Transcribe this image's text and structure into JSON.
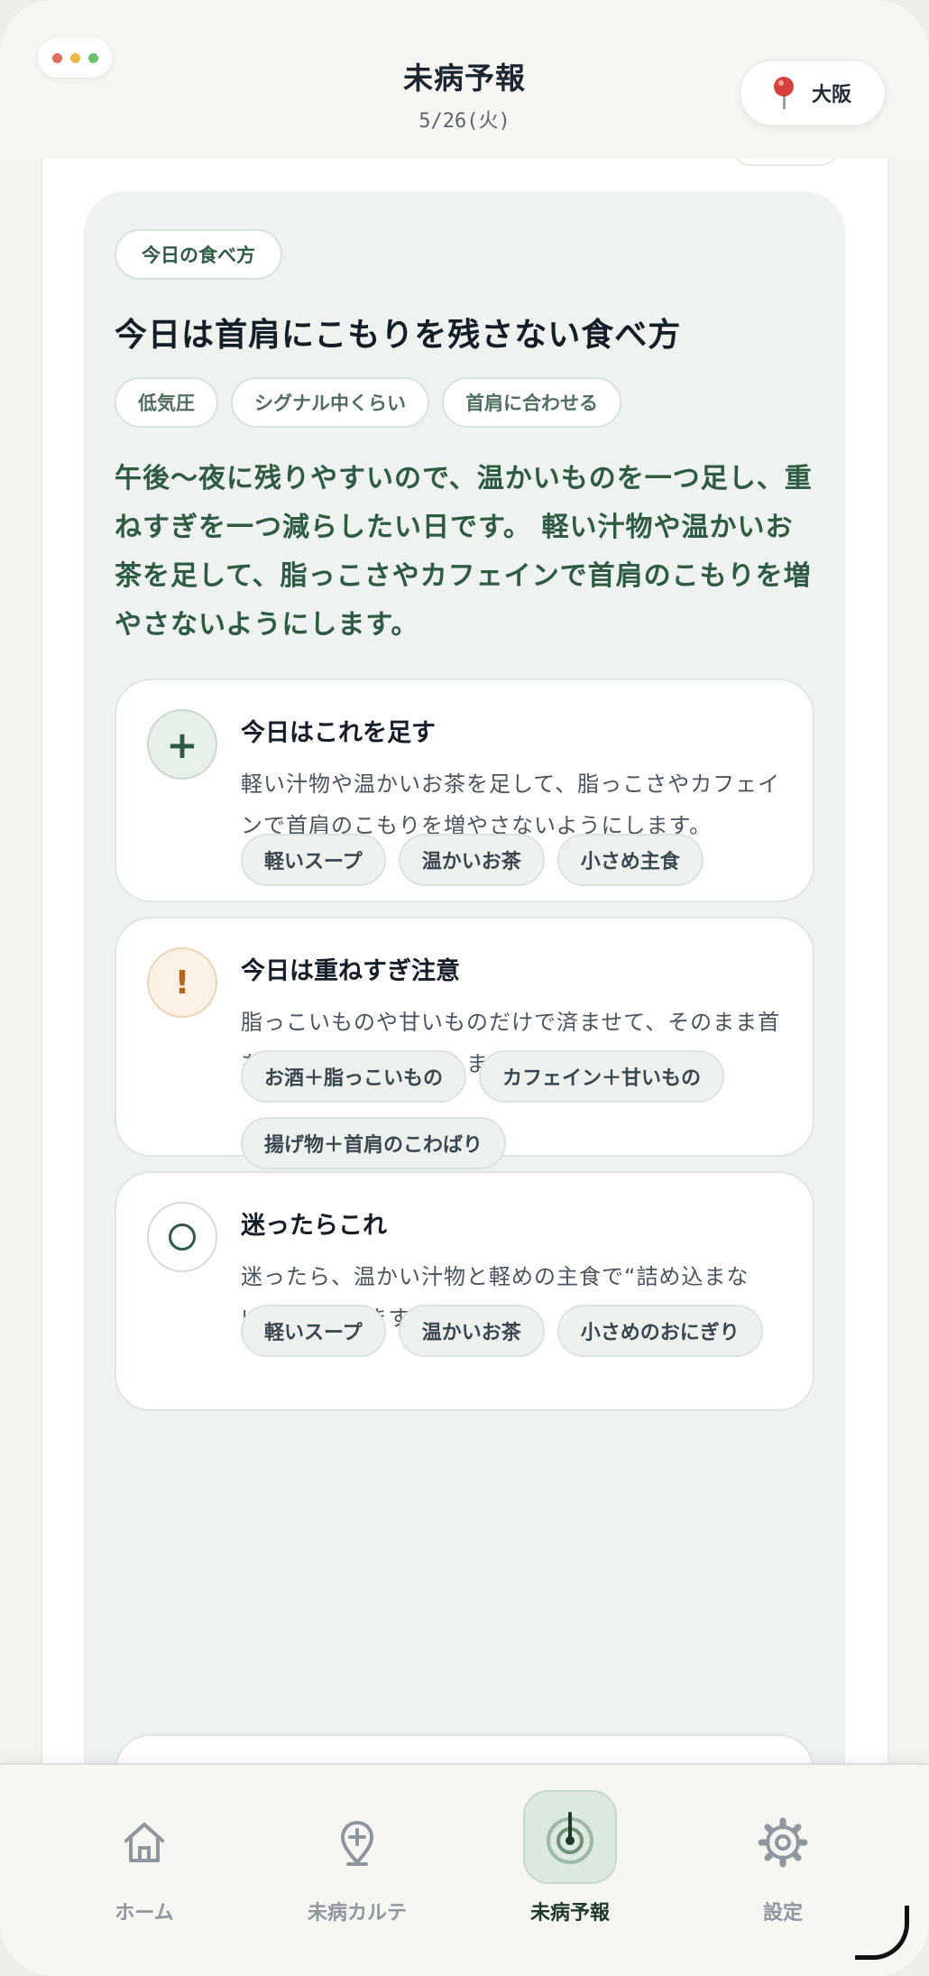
{
  "header": {
    "title": "未病予報",
    "date": "5/26(火)",
    "location": "大阪"
  },
  "card": {
    "badge": "今日の食べ方",
    "headline": "今日は首肩にこもりを残さない食べ方",
    "tags": [
      "低気圧",
      "シグナル中くらい",
      "首肩に合わせる"
    ],
    "summary": "午後〜夜に残りやすいので、温かいものを一つ足し、重ねすぎを一つ減らしたい日です。 軽い汁物や温かいお茶を足して、脂っこさやカフェインで首肩のこもりを増やさないようにします。",
    "add": {
      "icon": "plus-icon",
      "title": "今日はこれを足す",
      "body": "軽い汁物や温かいお茶を足して、脂っこさやカフェインで首肩のこもりを増やさないようにします。",
      "chips": [
        "軽いスープ",
        "温かいお茶",
        "小さめ主食"
      ]
    },
    "caution": {
      "icon": "warning-icon",
      "title": "今日は重ねすぎ注意",
      "body": "脂っこいものや甘いものだけで済ませて、そのまま首を固める流れに注意します。",
      "chips": [
        "お酒＋脂っこいもの",
        "カフェイン＋甘いもの",
        "揚げ物＋首肩のこわばり"
      ]
    },
    "fallback": {
      "icon": "circle-icon",
      "title": "迷ったらこれ",
      "body": "迷ったら、温かい汁物と軽めの主食で“詰め込まない”形に寄せます。",
      "chips": [
        "軽いスープ",
        "温かいお茶",
        "小さめのおにぎり"
      ]
    }
  },
  "nav": {
    "items": [
      {
        "label": "ホーム",
        "icon": "home-icon"
      },
      {
        "label": "未病カルテ",
        "icon": "medical-pin-icon"
      },
      {
        "label": "未病予報",
        "icon": "radar-icon",
        "active": true
      },
      {
        "label": "設定",
        "icon": "gear-icon"
      }
    ]
  },
  "colors": {
    "accent": "#2f5a44",
    "card_bg": "#eef3ef",
    "warning": "#b4661c"
  }
}
